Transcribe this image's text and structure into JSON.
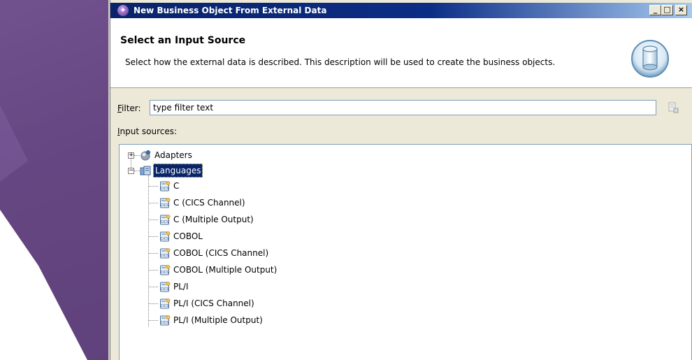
{
  "window": {
    "title": "New Business Object From External Data",
    "controls": {
      "minimize": "_",
      "maximize": "□",
      "close": "×"
    }
  },
  "header": {
    "title": "Select an Input Source",
    "description": "Select how the external data is described. This description will be used to create the business objects."
  },
  "filter": {
    "label_accel": "F",
    "label_rest": "ilter:",
    "value": "type filter text"
  },
  "sources": {
    "label_accel": "I",
    "label_rest": "nput sources:"
  },
  "tree": {
    "adapters": {
      "label": "Adapters",
      "expander": "+"
    },
    "languages": {
      "label": "Languages",
      "expander": "−",
      "children": [
        "C",
        "C (CICS Channel)",
        "C (Multiple Output)",
        "COBOL",
        "COBOL (CICS Channel)",
        "COBOL (Multiple Output)",
        "PL/I",
        "PL/I (CICS Channel)",
        "PL/I (Multiple Output)"
      ]
    }
  },
  "colors": {
    "title_bar": "#0a246a",
    "selection": "#0a246a",
    "desktop": "#55366f"
  }
}
